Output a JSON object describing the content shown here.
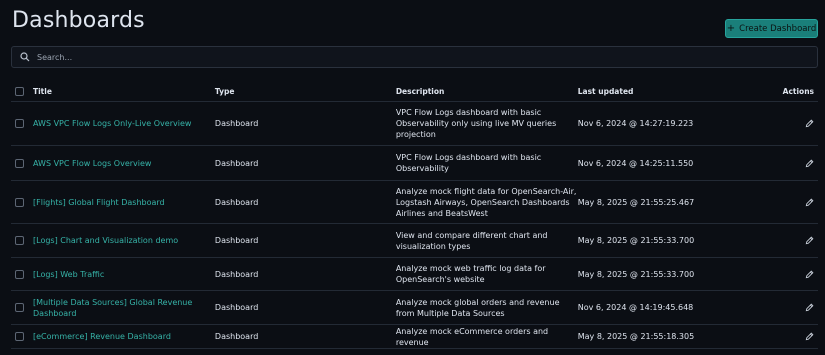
{
  "page": {
    "title": "Dashboards"
  },
  "create_button": {
    "label": "Create Dashboard"
  },
  "search": {
    "placeholder": "Search..."
  },
  "table": {
    "headers": {
      "title": "Title",
      "type": "Type",
      "description": "Description",
      "last_updated": "Last updated",
      "actions": "Actions"
    },
    "rows": [
      {
        "title": "AWS VPC Flow Logs Only-Live Overview",
        "type": "Dashboard",
        "description": "VPC Flow Logs dashboard with basic Observability only using live MV queries projection",
        "last_updated": "Nov 6, 2024 @ 14:27:19.223"
      },
      {
        "title": "AWS VPC Flow Logs Overview",
        "type": "Dashboard",
        "description": "VPC Flow Logs dashboard with basic Observability",
        "last_updated": "Nov 6, 2024 @ 14:25:11.550"
      },
      {
        "title": "[Flights] Global Flight Dashboard",
        "type": "Dashboard",
        "description": "Analyze mock flight data for OpenSearch-Air, Logstash Airways, OpenSearch Dashboards Airlines and BeatsWest",
        "last_updated": "May 8, 2025 @ 21:55:25.467"
      },
      {
        "title": "[Logs] Chart and Visualization demo",
        "type": "Dashboard",
        "description": "View and compare different chart and visualization types",
        "last_updated": "May 8, 2025 @ 21:55:33.700"
      },
      {
        "title": "[Logs] Web Traffic",
        "type": "Dashboard",
        "description": "Analyze mock web traffic log data for OpenSearch's website",
        "last_updated": "May 8, 2025 @ 21:55:33.700"
      },
      {
        "title": "[Multiple Data Sources] Global Revenue Dashboard",
        "type": "Dashboard",
        "description": "Analyze mock global orders and revenue from Multiple Data Sources",
        "last_updated": "Nov 6, 2024 @ 14:19:45.648"
      },
      {
        "title": "[eCommerce] Revenue Dashboard",
        "type": "Dashboard",
        "description": "Analyze mock eCommerce orders and revenue",
        "last_updated": "May 8, 2025 @ 21:55:18.305"
      }
    ]
  },
  "icons": {
    "search": "search-icon",
    "edit": "pencil-icon",
    "add": "plus-icon"
  },
  "colors": {
    "background": "#0b0e14",
    "accent": "#1a7f7a",
    "link": "#36b3a8",
    "text": "#dfe5ef"
  }
}
